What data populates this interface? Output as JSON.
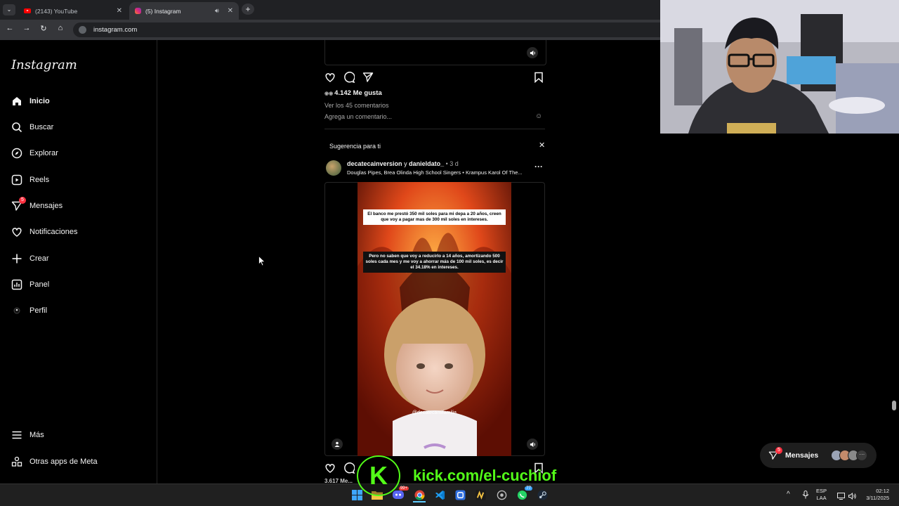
{
  "browser": {
    "tabs": [
      {
        "title": "(2143) YouTube",
        "icon": "youtube-icon",
        "active": false
      },
      {
        "title": "(5) Instagram",
        "icon": "instagram-icon",
        "active": true
      }
    ],
    "url": "instagram.com"
  },
  "sidebar": {
    "logo": "Instagram",
    "items": [
      {
        "label": "Inicio",
        "icon": "home-icon"
      },
      {
        "label": "Buscar",
        "icon": "search-icon"
      },
      {
        "label": "Explorar",
        "icon": "compass-icon"
      },
      {
        "label": "Reels",
        "icon": "reels-icon"
      },
      {
        "label": "Mensajes",
        "icon": "messenger-icon",
        "badge": "5"
      },
      {
        "label": "Notificaciones",
        "icon": "heart-icon"
      },
      {
        "label": "Crear",
        "icon": "plus-icon"
      },
      {
        "label": "Panel",
        "icon": "chart-icon"
      },
      {
        "label": "Perfil",
        "icon": "avatar-icon"
      }
    ],
    "bottom": [
      {
        "label": "Más",
        "icon": "menu-icon"
      },
      {
        "label": "Otras apps de Meta",
        "icon": "meta-apps-icon"
      }
    ]
  },
  "feed": {
    "prev_post": {
      "likes": "4.142 Me gusta",
      "view_comments": "Ver los 45 comentarios",
      "add_comment_placeholder": "Agrega un comentario..."
    },
    "suggestion_header": "Sugerencia para ti",
    "post": {
      "author": "decatecainversion",
      "joiner": "y",
      "coauthor": "danieldato_",
      "time": "• 3 d",
      "audio": "Douglas Pipes, Brea Olinda High School Singers • Krampus Karol Of The...",
      "caption_top": "El banco me prestó 350 mil soles para mi depa a 20 años, creen que voy a pagar mas de 300 mil soles en intereses.",
      "caption_bottom": "Pero no saben que voy a reducirlo a 14 años, amortizando 500 soles cada mes y me voy a ahorrar más de 100 mil soles, es decir el 34.18% en intereses.",
      "watermark": "@decatecamifamilia",
      "likes_partial": "3.617 Me..."
    }
  },
  "messages_pill": {
    "label": "Mensajes",
    "badge": "5"
  },
  "overlay": {
    "kick_letter": "K",
    "kick_url": "kick.com/el-cuchiof"
  },
  "taskbar": {
    "lang_top": "ESP",
    "lang_bottom": "LAA",
    "time": "02:12",
    "date": "3/11/2025",
    "badges": {
      "discord": "99+",
      "whatsapp": "77"
    }
  },
  "colors": {
    "kick_green": "#53fc18",
    "badge_red": "#ff3040",
    "bg": "#000000"
  }
}
